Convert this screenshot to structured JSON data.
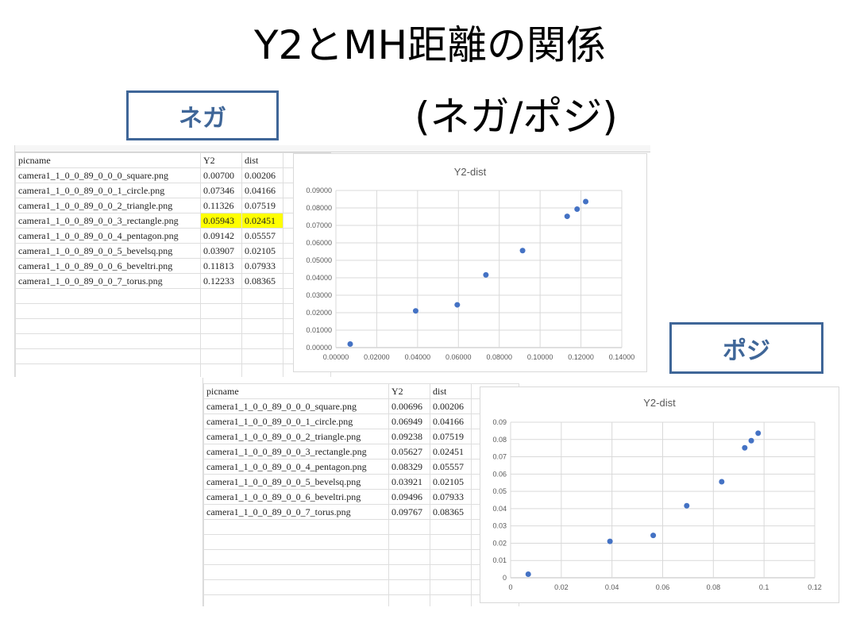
{
  "slide": {
    "title_line1": "Y2とMH距離の関係",
    "title_line2": "(ネガ/ポジ)",
    "negative_label": "ネガ",
    "positive_label": "ポジ",
    "accent_color": "#3f6698",
    "highlight_color": "#ffff00"
  },
  "negative_sheet": {
    "headers": [
      "picname",
      "Y2",
      "dist"
    ],
    "rows": [
      [
        "camera1_1_0_0_89_0_0_0_square.png",
        "0.00700",
        "0.00206"
      ],
      [
        "camera1_1_0_0_89_0_0_1_circle.png",
        "0.07346",
        "0.04166"
      ],
      [
        "camera1_1_0_0_89_0_0_2_triangle.png",
        "0.11326",
        "0.07519"
      ],
      [
        "camera1_1_0_0_89_0_0_3_rectangle.png",
        "0.05943",
        "0.02451"
      ],
      [
        "camera1_1_0_0_89_0_0_4_pentagon.png",
        "0.09142",
        "0.05557"
      ],
      [
        "camera1_1_0_0_89_0_0_5_bevelsq.png",
        "0.03907",
        "0.02105"
      ],
      [
        "camera1_1_0_0_89_0_0_6_beveltri.png",
        "0.11813",
        "0.07933"
      ],
      [
        "camera1_1_0_0_89_0_0_7_torus.png",
        "0.12233",
        "0.08365"
      ]
    ],
    "highlighted_row": 3
  },
  "positive_sheet": {
    "headers": [
      "picname",
      "Y2",
      "dist"
    ],
    "rows": [
      [
        "camera1_1_0_0_89_0_0_0_square.png",
        "0.00696",
        "0.00206"
      ],
      [
        "camera1_1_0_0_89_0_0_1_circle.png",
        "0.06949",
        "0.04166"
      ],
      [
        "camera1_1_0_0_89_0_0_2_triangle.png",
        "0.09238",
        "0.07519"
      ],
      [
        "camera1_1_0_0_89_0_0_3_rectangle.png",
        "0.05627",
        "0.02451"
      ],
      [
        "camera1_1_0_0_89_0_0_4_pentagon.png",
        "0.08329",
        "0.05557"
      ],
      [
        "camera1_1_0_0_89_0_0_5_bevelsq.png",
        "0.03921",
        "0.02105"
      ],
      [
        "camera1_1_0_0_89_0_0_6_beveltri.png",
        "0.09496",
        "0.07933"
      ],
      [
        "camera1_1_0_0_89_0_0_7_torus.png",
        "0.09767",
        "0.08365"
      ]
    ]
  },
  "chart_data": [
    {
      "type": "scatter",
      "title": "Y2-dist",
      "x": [
        0.007,
        0.07346,
        0.11326,
        0.05943,
        0.09142,
        0.03907,
        0.11813,
        0.12233
      ],
      "y": [
        0.00206,
        0.04166,
        0.07519,
        0.02451,
        0.05557,
        0.02105,
        0.07933,
        0.08365
      ],
      "xlim": [
        0,
        0.14
      ],
      "ylim": [
        0,
        0.09
      ],
      "xticks": [
        "0.00000",
        "0.02000",
        "0.04000",
        "0.06000",
        "0.08000",
        "0.10000",
        "0.12000",
        "0.14000"
      ],
      "yticks": [
        "0.00000",
        "0.01000",
        "0.02000",
        "0.03000",
        "0.04000",
        "0.05000",
        "0.06000",
        "0.07000",
        "0.08000",
        "0.09000"
      ],
      "grid": true,
      "marker_color": "#4472c4"
    },
    {
      "type": "scatter",
      "title": "Y2-dist",
      "x": [
        0.00696,
        0.06949,
        0.09238,
        0.05627,
        0.08329,
        0.03921,
        0.09496,
        0.09767
      ],
      "y": [
        0.00206,
        0.04166,
        0.07519,
        0.02451,
        0.05557,
        0.02105,
        0.07933,
        0.08365
      ],
      "xlim": [
        0,
        0.12
      ],
      "ylim": [
        0,
        0.09
      ],
      "xticks": [
        "0",
        "0.02",
        "0.04",
        "0.06",
        "0.08",
        "0.1",
        "0.12"
      ],
      "yticks": [
        "0",
        "0.01",
        "0.02",
        "0.03",
        "0.04",
        "0.05",
        "0.06",
        "0.07",
        "0.08",
        "0.09"
      ],
      "grid": true,
      "marker_color": "#4472c4"
    }
  ]
}
